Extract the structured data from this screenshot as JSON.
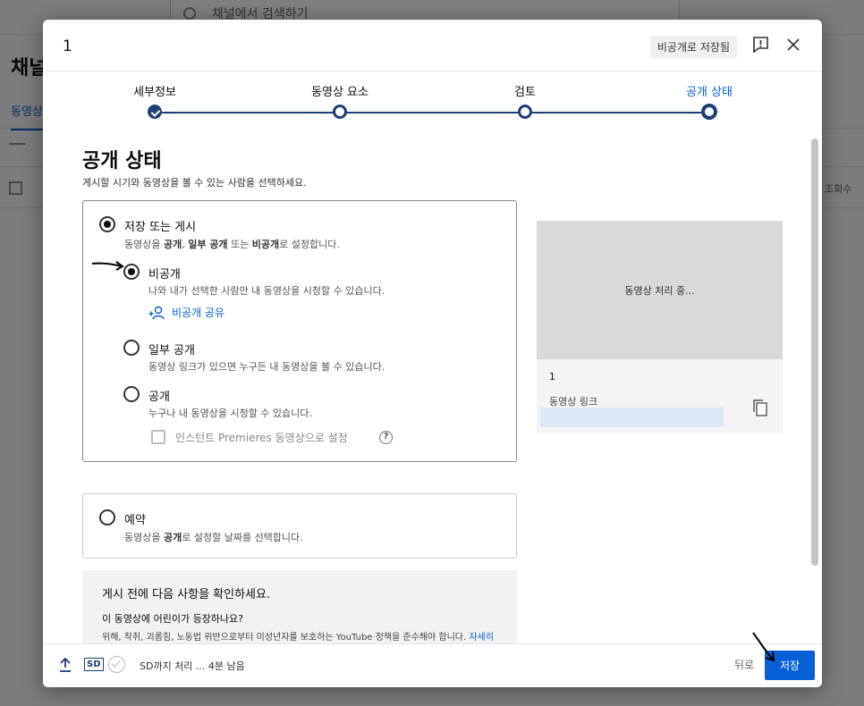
{
  "background": {
    "search_placeholder": "채널에서 검색하기",
    "page_title": "채널",
    "tab_label": "동영상",
    "views_col": "조회수"
  },
  "dialog": {
    "title": "1",
    "saved_badge": "비공개로 저장됨"
  },
  "stepper": {
    "steps": [
      {
        "label": "세부정보",
        "state": "done"
      },
      {
        "label": "동영상 요소",
        "state": "visited"
      },
      {
        "label": "검토",
        "state": "visited"
      },
      {
        "label": "공개 상태",
        "state": "current"
      }
    ]
  },
  "visibility": {
    "title": "공개 상태",
    "subtitle": "게시할 시기와 동영상을 볼 수 있는 사람을 선택하세요.",
    "save_or_publish": {
      "label": "저장 또는 게시",
      "desc_parts": [
        "동영상을 ",
        "공개",
        ", ",
        "일부 공개",
        " 또는 ",
        "비공개",
        "로 설정합니다."
      ]
    },
    "private": {
      "label": "비공개",
      "desc": "나와 내가 선택한 사람만 내 동영상을 시청할 수 있습니다.",
      "share_label": "비공개 공유"
    },
    "unlisted": {
      "label": "일부 공개",
      "desc": "동영상 링크가 있으면 누구든 내 동영상을 볼 수 있습니다."
    },
    "public": {
      "label": "공개",
      "desc": "누구나 내 동영상을 시청할 수 있습니다.",
      "premiere_label": "인스턴트 Premieres 동영상으로 설정",
      "help": "?"
    },
    "schedule": {
      "label": "예약",
      "desc_parts": [
        "동영상을 ",
        "공개",
        "로 설정할 날짜를 선택합니다."
      ]
    },
    "checklist": {
      "title": "게시 전에 다음 사항을 확인하세요.",
      "question": "이 동영상에 어린이가 등장하나요?",
      "text": "위해, 착취, 괴롭힘, 노동법 위반으로부터 미성년자를 보호하는 YouTube 정책을 준수해야 합니다.",
      "link": "자세히 알아보기"
    }
  },
  "preview": {
    "processing": "동영상 처리 중...",
    "video_name": "1",
    "link_label": "동영상 링크"
  },
  "footer": {
    "sd": "SD",
    "status": "SD까지 처리 ... 4분 남음",
    "back_label": "뒤로",
    "save_label": "저장"
  }
}
